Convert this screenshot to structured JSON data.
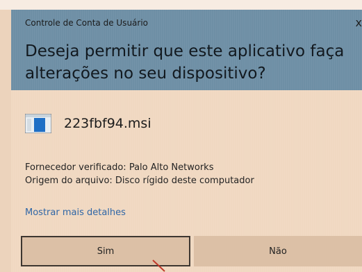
{
  "dialog": {
    "title": "Controle de Conta de Usuário",
    "close_glyph": "x",
    "question": "Deseja permitir que este aplicativo faça alterações no seu dispositivo?",
    "file": {
      "icon": "installer-file-icon",
      "name": "223fbf94.msi"
    },
    "publisher": "Fornecedor verificado: Palo Alto Networks",
    "origin": "Origem do arquivo: Disco rígido deste computador",
    "more_details": "Mostrar mais detalhes",
    "buttons": {
      "yes": "Sim",
      "no": "Não"
    }
  },
  "colors": {
    "header_bg": "#6e8fa5",
    "content_bg": "#f0d8c1",
    "link": "#2f66a6",
    "cursor": "#c0392b"
  }
}
